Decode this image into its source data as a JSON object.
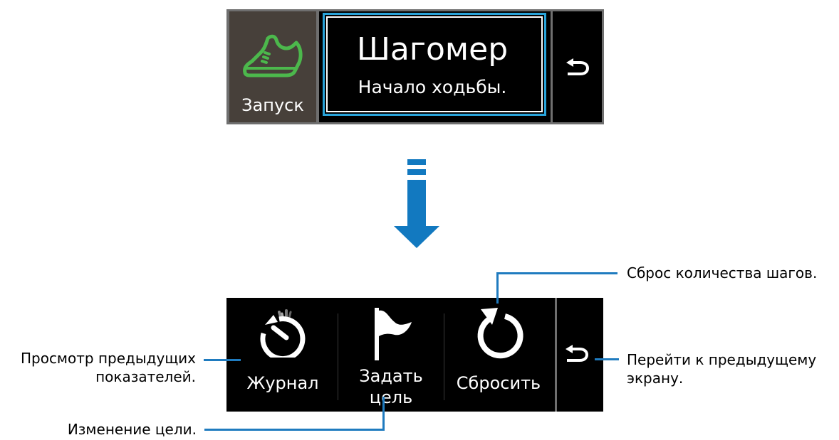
{
  "top_screen": {
    "start_label": "Запуск",
    "title": "Шагомер",
    "subtitle": "Начало ходьбы."
  },
  "bottom_screen": {
    "log_label": "Журнал",
    "goal_label_line1": "Задать",
    "goal_label_line2": "цель",
    "reset_label": "Сбросить"
  },
  "callouts": {
    "reset": "Сброс количества шагов.",
    "log_line1": "Просмотр предыдущих",
    "log_line2": "показателей.",
    "back_line1": "Перейти к предыдущему",
    "back_line2": "экрану.",
    "goal": "Изменение цели."
  },
  "colors": {
    "accent": "#1279c0",
    "highlight": "#29a3d9",
    "shoe_icon": "#4cb84c",
    "start_bg": "#47403a"
  },
  "icons": [
    "shoe-icon",
    "back-icon",
    "log-icon",
    "flag-icon",
    "reset-icon",
    "down-arrow-icon"
  ]
}
